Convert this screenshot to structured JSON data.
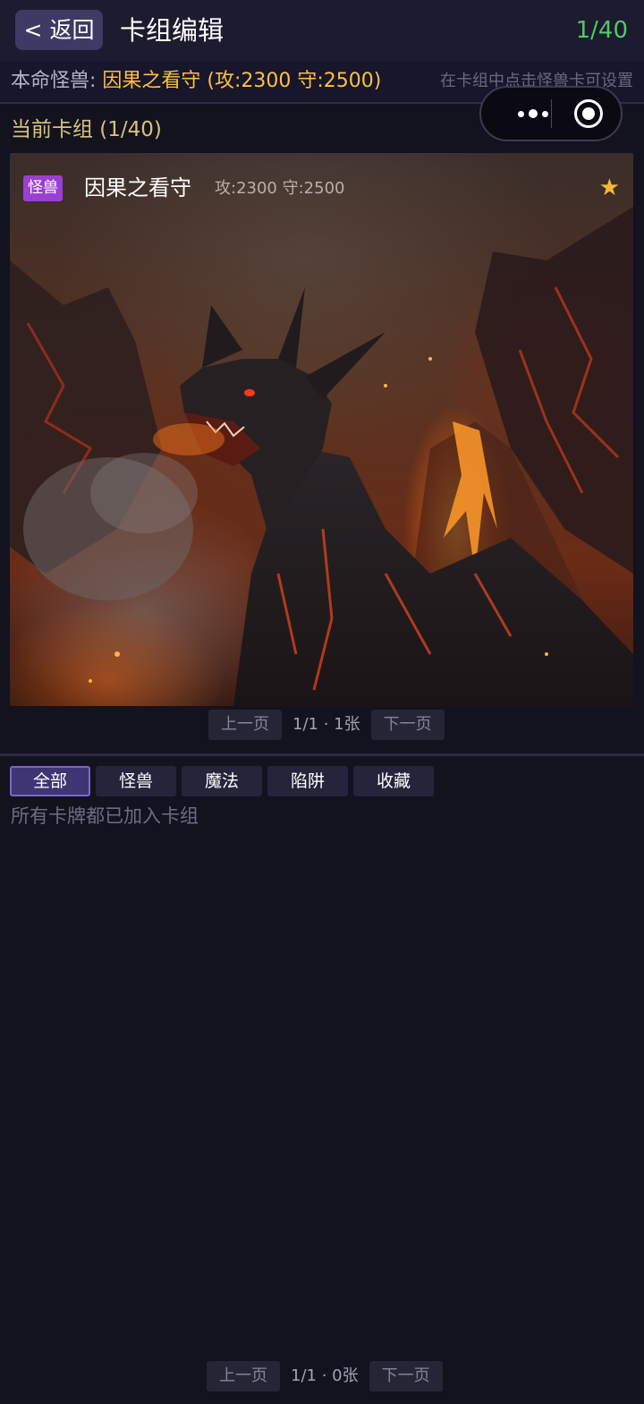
{
  "header": {
    "back_label": "< 返回",
    "title": "卡组编辑",
    "deck_count": "1/40"
  },
  "main_monster": {
    "label": "本命怪兽: ",
    "value": "因果之看守 (攻:2300 守:2500)",
    "hint": "在卡组中点击怪兽卡可设置"
  },
  "deck": {
    "title": "当前卡组 (1/40)",
    "cards": [
      {
        "type": "怪兽",
        "name": "因果之看守",
        "stats": "攻:2300 守:2500",
        "favorite_icon": "★",
        "image": "black-dragon-volcano-illustration"
      }
    ],
    "pager": {
      "prev": "上一页",
      "info": "1/1 · 1张",
      "next": "下一页"
    }
  },
  "filters": {
    "tabs": [
      {
        "label": "全部",
        "active": true
      },
      {
        "label": "怪兽",
        "active": false
      },
      {
        "label": "魔法",
        "active": false
      },
      {
        "label": "陷阱",
        "active": false
      },
      {
        "label": "收藏",
        "active": false
      }
    ]
  },
  "pool": {
    "empty_message": "所有卡牌都已加入卡组",
    "pager": {
      "prev": "上一页",
      "info": "1/1 · 0张",
      "next": "下一页"
    }
  },
  "colors": {
    "background": "#13121f",
    "accent": "#ffbf45",
    "count_green": "#55c766",
    "badge_purple": "#9a3fd4"
  }
}
